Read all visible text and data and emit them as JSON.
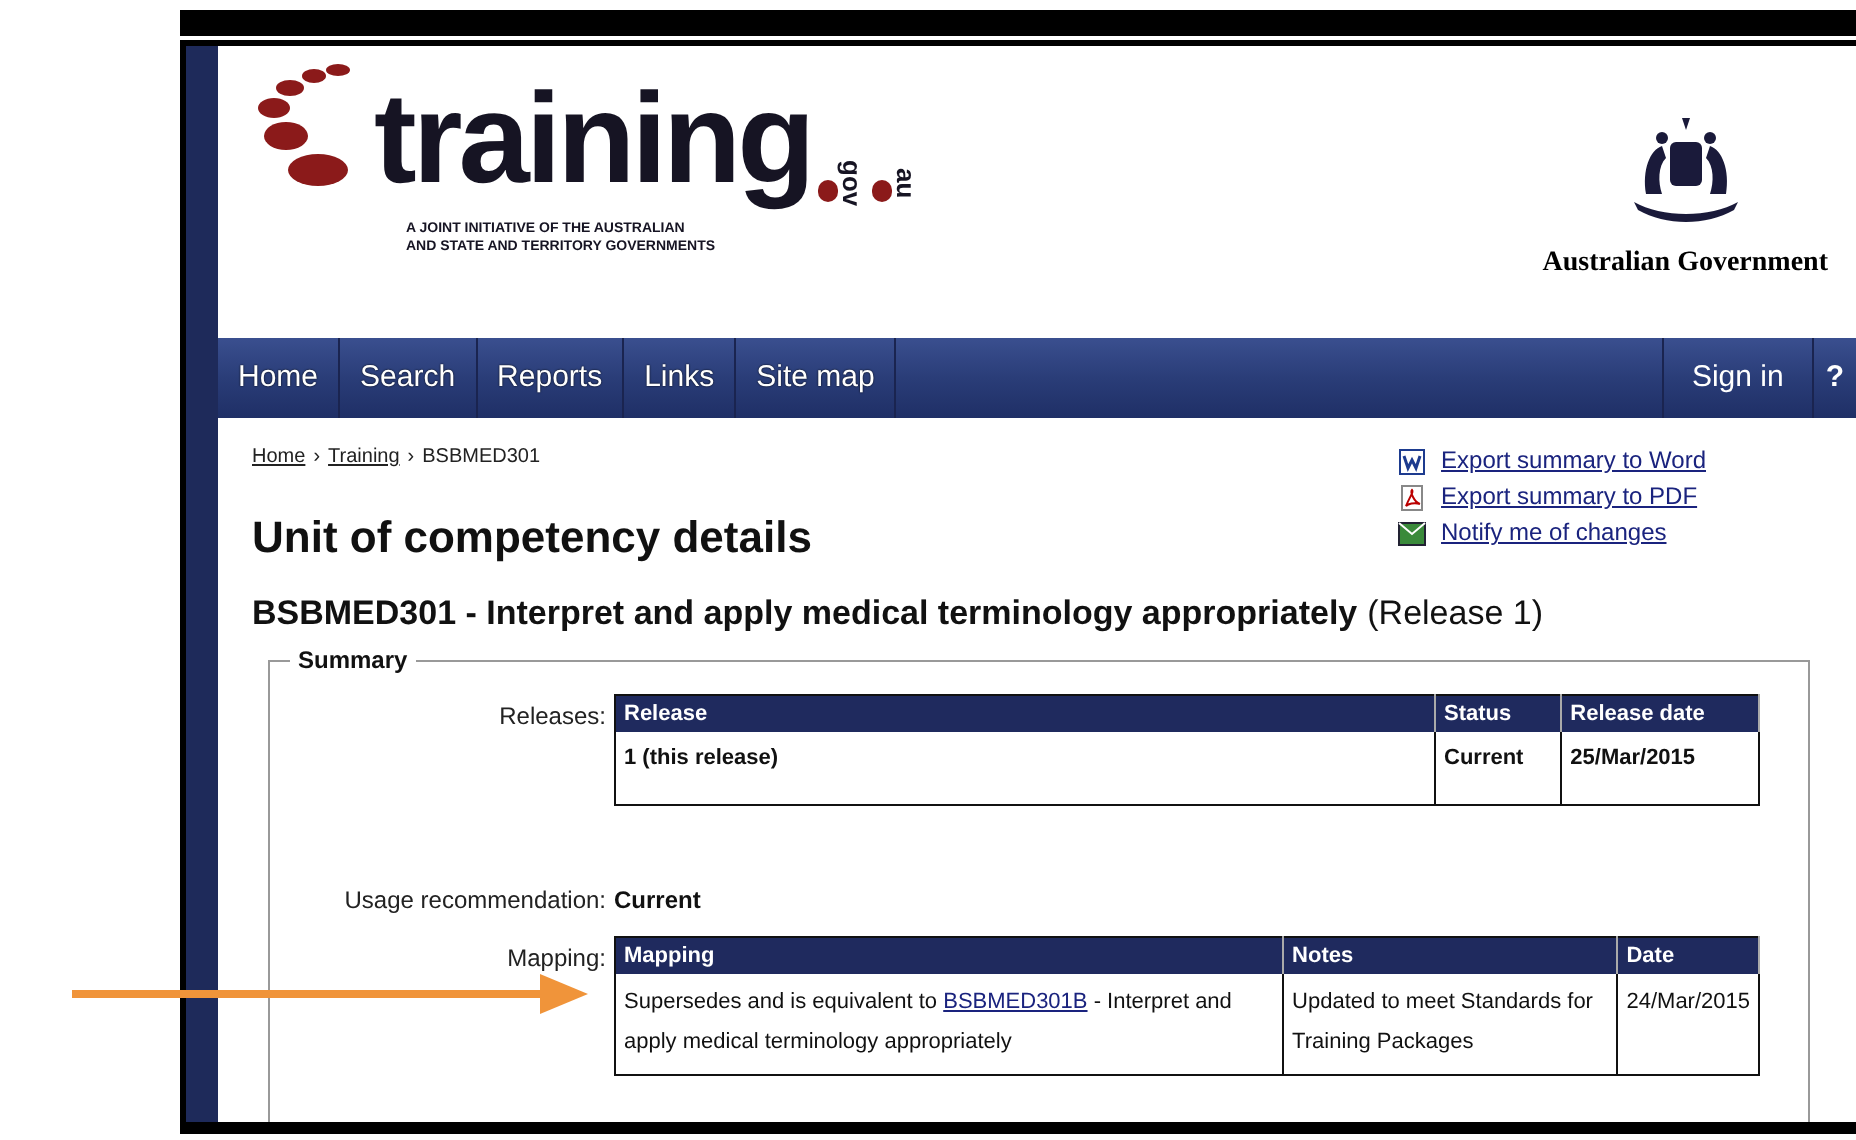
{
  "logo": {
    "word": "training",
    "suffix_1": "gov",
    "suffix_2": "au",
    "tagline_1": "A JOINT INITIATIVE OF THE AUSTRALIAN",
    "tagline_2": "AND STATE AND TERRITORY GOVERNMENTS"
  },
  "government": {
    "label": "Australian Government"
  },
  "nav": {
    "items": [
      "Home",
      "Search",
      "Reports",
      "Links",
      "Site map"
    ],
    "sign_in": "Sign in",
    "help": "?"
  },
  "breadcrumb": [
    {
      "label": "Home",
      "link": true
    },
    {
      "label": "Training",
      "link": true
    },
    {
      "label": "BSBMED301",
      "link": false
    }
  ],
  "breadcrumb_separator": "›",
  "actions": [
    {
      "kind": "word",
      "label": "Export summary to Word"
    },
    {
      "kind": "pdf",
      "label": "Export summary to PDF"
    },
    {
      "kind": "mail",
      "label": "Notify me of changes"
    }
  ],
  "title": "Unit of competency details",
  "subtitle": {
    "code_title": "BSBMED301 - Interpret and apply medical terminology appropriately",
    "release": "(Release 1)"
  },
  "summary": {
    "legend": "Summary",
    "releases_label": "Releases:",
    "releases_table": {
      "columns": [
        "Release",
        "Status",
        "Release date"
      ],
      "rows": [
        [
          "1 (this release)",
          "Current",
          "25/Mar/2015"
        ]
      ]
    },
    "usage_label": "Usage recommendation:",
    "usage_value": "Current",
    "mapping_label": "Mapping:",
    "mapping_table": {
      "columns": [
        "Mapping",
        "Notes",
        "Date"
      ],
      "rows": [
        {
          "before": "Supersedes and is equivalent to ",
          "link": "BSBMED301B",
          "after": " - Interpret and apply medical terminology appropriately",
          "notes": "Updated to meet Standards for Training Packages",
          "date": "24/Mar/2015"
        }
      ]
    }
  }
}
